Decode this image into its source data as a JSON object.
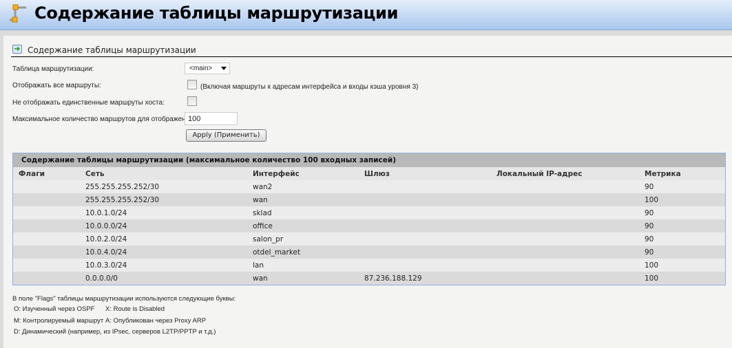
{
  "header": {
    "title": "Содержание таблицы маршрутизации"
  },
  "section": {
    "title": "Содержание таблицы маршрутизации"
  },
  "form": {
    "table_label": "Таблица маршрутизации:",
    "table_value": "<main>",
    "show_all_label": "Отображать все маршруты:",
    "show_all_note": "(Включая маршруты к адресам интерфейса и входы кэша уровня 3)",
    "hide_host_label": "Не отображать единственные маршруты хоста:",
    "max_label": "Максимальное количество маршрутов для отображения:",
    "max_value": "100",
    "apply_label": "Apply (Применить)"
  },
  "table": {
    "caption": "Содержание таблицы маршрутизации (максимальное количество 100 входных записей)",
    "headers": [
      "Флаги",
      "Сеть",
      "Интерфейс",
      "Шлюз",
      "Локальный IP-адрес",
      "Метрика"
    ],
    "rows": [
      [
        "",
        "255.255.255.252/30",
        "wan2",
        "",
        "",
        "90"
      ],
      [
        "",
        "255.255.255.252/30",
        "wan",
        "",
        "",
        "100"
      ],
      [
        "",
        "10.0.1.0/24",
        "sklad",
        "",
        "",
        "90"
      ],
      [
        "",
        "10.0.0.0/24",
        "office",
        "",
        "",
        "90"
      ],
      [
        "",
        "10.0.2.0/24",
        "salon_pr",
        "",
        "",
        "90"
      ],
      [
        "",
        "10.0.4.0/24",
        "otdel_market",
        "",
        "",
        "90"
      ],
      [
        "",
        "10.0.3.0/24",
        "lan",
        "",
        "",
        "100"
      ],
      [
        "",
        "0.0.0.0/0",
        "wan",
        "87.236.188.129",
        "",
        "100"
      ]
    ]
  },
  "legend": {
    "intro": "В поле \"Flags\" таблицы маршрутизации используются следующие буквы:",
    "o": "O: Изученный через OSPF",
    "x": "X: Route is Disabled",
    "m": "M: Контролируемый маршрут",
    "a": "A: Опубликован через Proxy ARP",
    "d": "D: Динамический (например, из IPsec, серверов L2TP/PPTP и т.д.)"
  }
}
